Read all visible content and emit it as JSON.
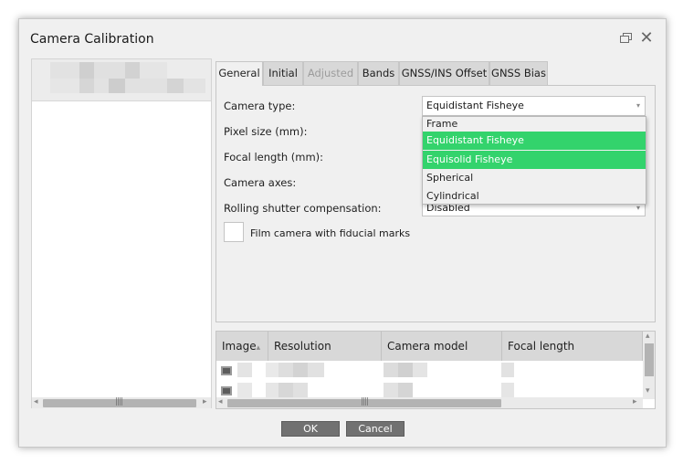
{
  "dialog": {
    "title": "Camera Calibration",
    "restore_icon": "restore-icon",
    "close_glyph": "✕"
  },
  "tabs": [
    {
      "label": "General",
      "state": "active"
    },
    {
      "label": "Initial",
      "state": "normal"
    },
    {
      "label": "Adjusted",
      "state": "disabled"
    },
    {
      "label": "Bands",
      "state": "normal"
    },
    {
      "label": "GNSS/INS Offset",
      "state": "normal"
    },
    {
      "label": "GNSS Bias",
      "state": "normal"
    }
  ],
  "general": {
    "camera_type_label": "Camera type:",
    "camera_type_value": "Equidistant Fisheye",
    "pixel_size_label": "Pixel size (mm):",
    "focal_length_label": "Focal length (mm):",
    "camera_axes_label": "Camera axes:",
    "rolling_shutter_label": "Rolling shutter compensation:",
    "rolling_shutter_value": "Disabled",
    "film_camera_label": "Film camera with fiducial marks",
    "film_camera_checked": false
  },
  "camera_type_dropdown": {
    "options": [
      "Frame",
      "Equidistant Fisheye",
      "Equisolid Fisheye",
      "Spherical",
      "Cylindrical"
    ],
    "highlighted": [
      "Equidistant Fisheye",
      "Equisolid Fisheye"
    ],
    "highlight_color": "#33d36c"
  },
  "table": {
    "columns": [
      "Image",
      "Resolution",
      "Camera model",
      "Focal length"
    ],
    "sort_indicator": "▴"
  },
  "buttons": {
    "ok": "OK",
    "cancel": "Cancel"
  },
  "scrollbar": {
    "grip": "||||",
    "left_arrow": "◂",
    "right_arrow": "▸",
    "up_arrow": "▴",
    "down_arrow": "▾"
  }
}
